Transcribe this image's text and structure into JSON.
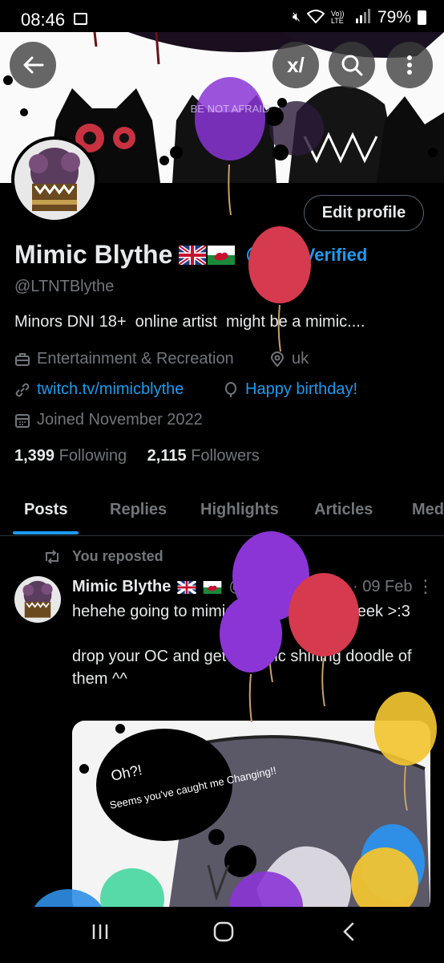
{
  "status_bar": {
    "time": "08:46",
    "battery": "79%",
    "icons": [
      "gallery-icon",
      "mute-icon",
      "wifi-icon",
      "volte-icon",
      "signal-icon",
      "battery-icon"
    ],
    "volte_label": "Vo)) LTE"
  },
  "header": {
    "back_icon": "arrow-left-icon",
    "grok_label": "x/",
    "search_icon": "search-icon",
    "more_icon": "more-vertical-icon"
  },
  "banner": {
    "balloon_text": "BE NOT AFRAID"
  },
  "profile": {
    "edit_label": "Edit profile",
    "name": "Mimic Blythe",
    "get_verified": "Get Verified",
    "handle": "@LTNTBlythe",
    "bio": "Minors DNI 18+  online artist  might be a mimic....",
    "category": "Entertainment & Recreation",
    "location": "uk",
    "website": "twitch.tv/mimicblythe",
    "birthday": "Happy birthday!",
    "joined": "Joined November 2022",
    "following_count": "1,399",
    "following_label": "Following",
    "followers_count": "2,115",
    "followers_label": "Followers"
  },
  "tabs": [
    "Posts",
    "Replies",
    "Highlights",
    "Articles",
    "Med"
  ],
  "post": {
    "repost_label": "You reposted",
    "author": "Mimic Blythe",
    "handle": "@LTNTBl...",
    "date": "· 09 Feb",
    "text": "hehehe going to mimic my people this week >:3\n\ndrop your OC and get a mimic shifting doodle of them ^^",
    "image_text_1": "Oh?!",
    "image_text_2": "Seems you've caught me Changing!!"
  },
  "colors": {
    "accent": "#1d9bf0",
    "secondary_text": "#71767b",
    "primary_text": "#e7e9ea",
    "balloon_red": "#d63a4e",
    "balloon_purple": "#8b35d6",
    "balloon_yellow": "#f2c432",
    "balloon_blue": "#2f8fe6",
    "balloon_green": "#47d6a0"
  }
}
